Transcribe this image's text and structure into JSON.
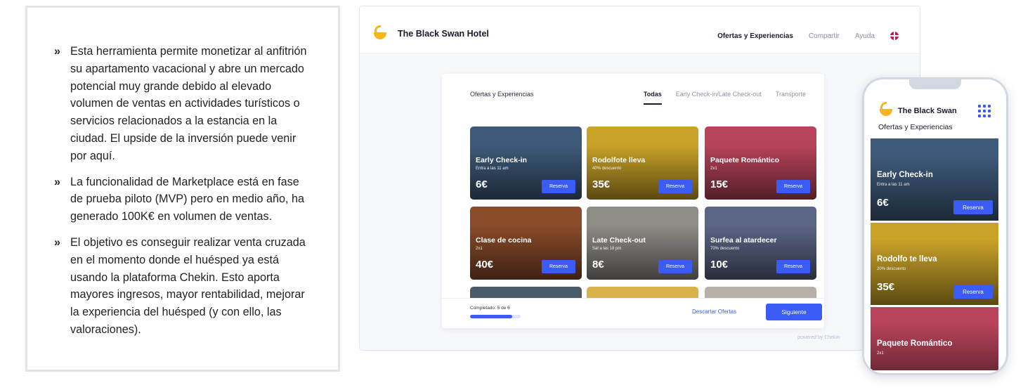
{
  "bullets": [
    "Esta herramienta permite monetizar al anfitrión su apartamento vacacional y abre un mercado potencial muy grande debido al elevado volumen de ventas en actividades turísticos o servicios relacionados a la estancia en la ciudad. El upside de la inversión puede venir por aquí.",
    "La funcionalidad de Marketplace está en fase de prueba piloto (MVP) pero en medio año, ha generado 100K€ en volumen de ventas.",
    "El objetivo es conseguir realizar venta cruzada en el momento donde el huésped ya está usando la plataforma Chekin. Esto aporta mayores ingresos, mayor rentabilidad, mejorar la experiencia del huésped (y con ello, las valoraciones)."
  ],
  "bullet_marker": "»",
  "desktop": {
    "hotel_name": "The Black Swan Hotel",
    "nav": [
      "Ofertas y Experiencias",
      "Compartir",
      "Ayuda"
    ],
    "panel_title": "Ofertas y Experiencias",
    "tabs": [
      "Todas",
      "Early Check-in/Late Check-out",
      "Transporte"
    ],
    "offers": [
      {
        "name": "Early Check-in",
        "sub": "Entra a las 11 am",
        "price": "6€",
        "cta": "Reserva",
        "color": "#3e5a7a"
      },
      {
        "name": "Rodolfote lleva",
        "sub": "40% descuento",
        "price": "35€",
        "cta": "Reserva",
        "color": "#c9a227"
      },
      {
        "name": "Paquete Romántico",
        "sub": "2x1",
        "price": "15€",
        "cta": "Reserva",
        "color": "#b8435a"
      },
      {
        "name": "Clase de cocina",
        "sub": "2x1",
        "price": "40€",
        "cta": "Reserva",
        "color": "#8a4b2a"
      },
      {
        "name": "Late Check-out",
        "sub": "Sal a las 18 pm",
        "price": "8€",
        "cta": "Reserva",
        "color": "#8f8c88"
      },
      {
        "name": "Surfea al atardecer",
        "sub": "70% descuento",
        "price": "10€",
        "cta": "Reserva",
        "color": "#5b6585"
      },
      {
        "name": "",
        "sub": "",
        "price": "",
        "cta": "",
        "color": "#4a5a66"
      },
      {
        "name": "",
        "sub": "",
        "price": "",
        "cta": "",
        "color": "#d9b24a"
      },
      {
        "name": "",
        "sub": "",
        "price": "",
        "cta": "",
        "color": "#b7b0a8"
      }
    ],
    "progress_label": "Completado: 5 de 6",
    "progress_fraction": 0.833,
    "discard_label": "Descartar Ofertas",
    "next_label": "Siguiente",
    "powered_by": "powered by Chekin"
  },
  "phone": {
    "hotel_name": "The Black Swan",
    "subtitle": "Ofertas y Experiencias",
    "offers": [
      {
        "name": "Early Check-in",
        "sub": "Entra a las 11 am",
        "price": "6€",
        "cta": "Reserva",
        "color": "#3e5a7a"
      },
      {
        "name": "Rodolfo te lleva",
        "sub": "20% descuento",
        "price": "35€",
        "cta": "Reserva",
        "color": "#c9a227"
      },
      {
        "name": "Paquete Romántico",
        "sub": "2x1",
        "price": "",
        "cta": "",
        "color": "#b8435a"
      }
    ]
  },
  "colors": {
    "accent": "#3b5bf5",
    "logo": "#f5b61a"
  }
}
